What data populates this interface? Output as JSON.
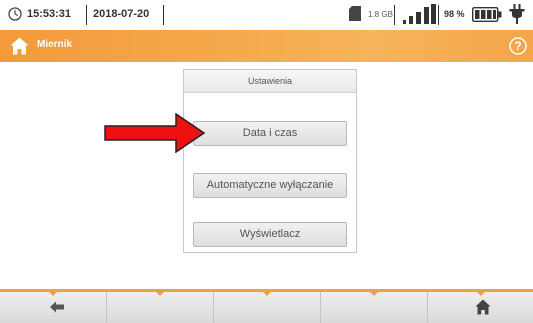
{
  "status_bar": {
    "time": "15:53:31",
    "date": "2018-07-20",
    "storage": "1.8 GB",
    "battery": "98 %",
    "icons": [
      "clock-icon",
      "sd-card-icon",
      "signal-icon",
      "battery-icon",
      "plug-icon"
    ]
  },
  "header": {
    "title": "Miernik",
    "icons": [
      "home-icon",
      "help-icon"
    ],
    "color": "#f5a84a"
  },
  "panel": {
    "title": "Ustawienia",
    "buttons": [
      {
        "label": "Data i czas"
      },
      {
        "label": "Automatyczne wyłączanie"
      },
      {
        "label": "Wyświetlacz"
      }
    ]
  },
  "annotation": {
    "arrow_color": "#ee1111"
  },
  "toolbar": {
    "buttons": [
      "back-arrow-icon",
      "",
      "",
      "",
      "home-icon"
    ],
    "accent": "#f0a046"
  }
}
